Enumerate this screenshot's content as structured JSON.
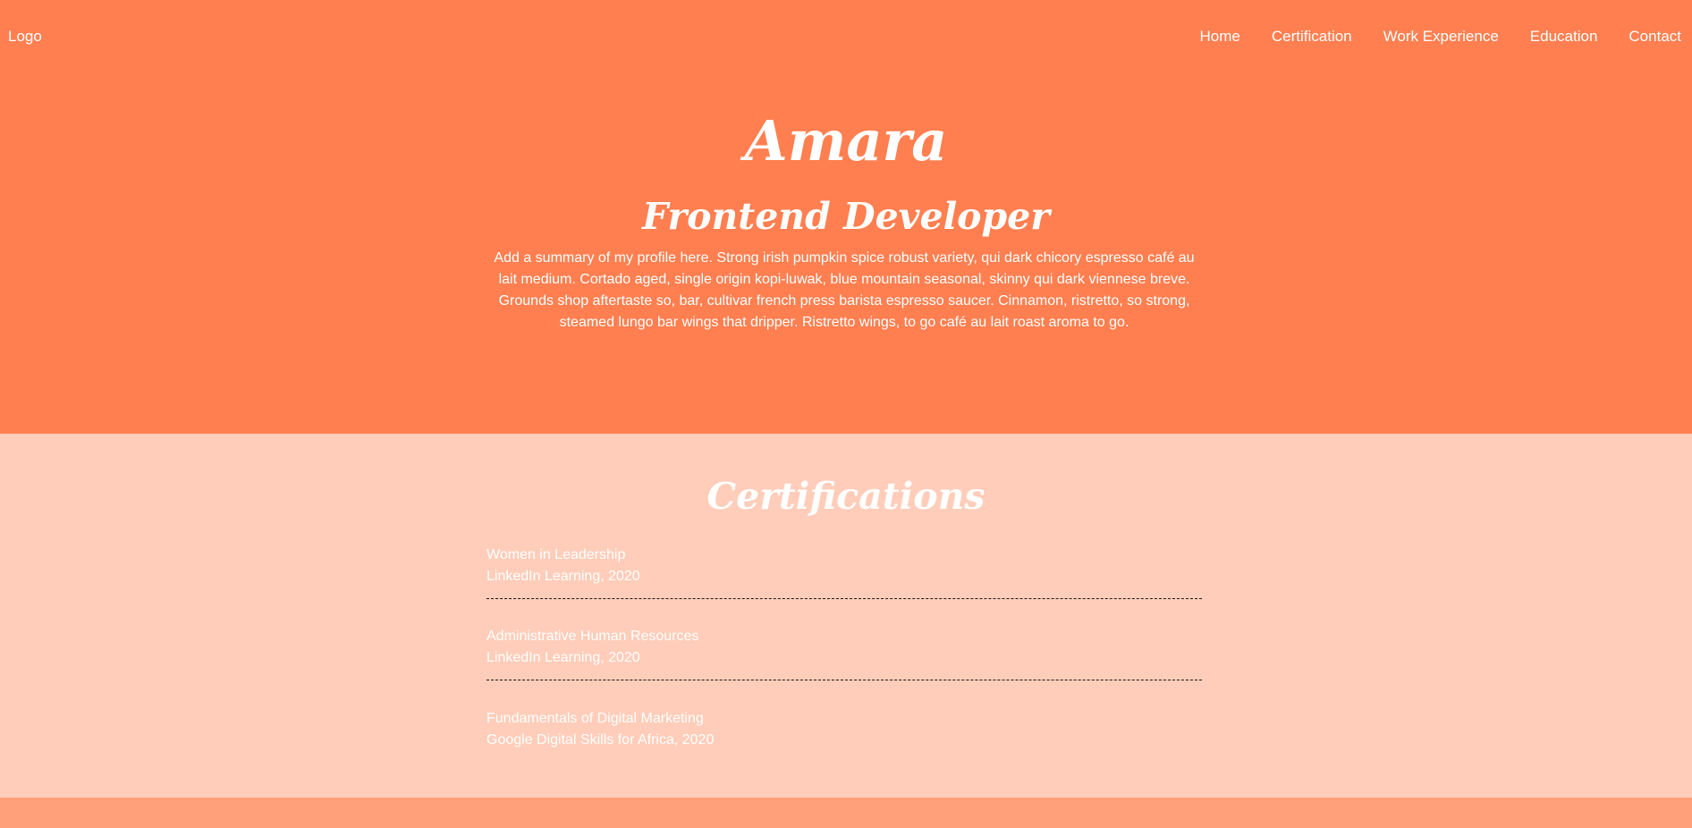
{
  "nav": {
    "logo": "Logo",
    "links": [
      "Home",
      "Certification",
      "Work Experience",
      "Education",
      "Contact"
    ]
  },
  "hero": {
    "name": "Amara",
    "role": "Frontend Developer",
    "summary": "Add a summary of my profile here. Strong irish pumpkin spice robust variety, qui dark chicory espresso café au lait medium. Cortado aged, single origin kopi-luwak, blue mountain seasonal, skinny qui dark viennese breve. Grounds shop aftertaste so, bar, cultivar french press barista espresso saucer. Cinnamon, ristretto, so strong, steamed lungo bar wings that dripper. Ristretto wings, to go café au lait roast aroma to go."
  },
  "certifications": {
    "title": "Certifications",
    "items": [
      {
        "name": "Women in Leadership",
        "source": "LinkedIn Learning, 2020"
      },
      {
        "name": "Administrative Human Resources",
        "source": "LinkedIn Learning, 2020"
      },
      {
        "name": "Fundamentals of Digital Marketing",
        "source": "Google Digital Skills for Africa, 2020"
      }
    ]
  },
  "colors": {
    "hero_bg": "#ff7f50",
    "certs_bg": "#ffcdb9",
    "footer_bg": "#ffa07a",
    "text": "#ffffff",
    "divider": "#1a1a1a"
  }
}
